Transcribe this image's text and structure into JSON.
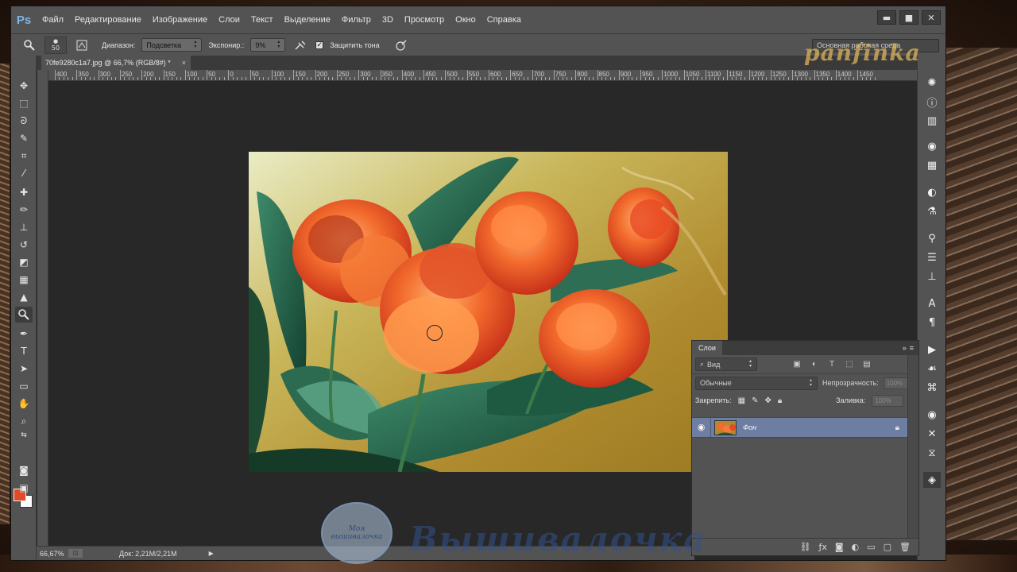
{
  "app": {
    "logo": "Ps"
  },
  "menu": [
    "Файл",
    "Редактирование",
    "Изображение",
    "Слои",
    "Текст",
    "Выделение",
    "Фильтр",
    "3D",
    "Просмотр",
    "Окно",
    "Справка"
  ],
  "window_controls": {
    "minimize": "▬",
    "maximize": "■",
    "close": "✕"
  },
  "options": {
    "brush_size": "50",
    "range_label": "Диапазон:",
    "range_value": "Подсветка",
    "exposure_label": "Экспонир.:",
    "exposure_value": "9%",
    "protect_tones_label": "Защитить тона",
    "protect_tones_checked": true,
    "workspace": "Основная рабочая среда"
  },
  "document_tab": {
    "title": "70fe9280c1a7.jpg @ 66,7% (RGB/8#) *",
    "close": "×"
  },
  "ruler": {
    "top_labels": [
      "400",
      "350",
      "300",
      "250",
      "200",
      "150",
      "100",
      "50",
      "0",
      "50",
      "100",
      "150",
      "200",
      "250",
      "300",
      "350",
      "400",
      "450",
      "500",
      "550",
      "600",
      "650",
      "700",
      "750",
      "800",
      "850",
      "900",
      "950",
      "1000",
      "1050",
      "1100",
      "1150",
      "1200",
      "1250",
      "1300",
      "1350",
      "1400",
      "1450"
    ]
  },
  "status": {
    "zoom": "66,67%",
    "doc": "Док: 2,21M/2,21M"
  },
  "layers_panel": {
    "title": "Слои",
    "filter": "Вид",
    "blend_mode": "Обычные",
    "opacity_label": "Непрозрачность:",
    "opacity_value": "100%",
    "lock_label": "Закрепить:",
    "fill_label": "Заливка:",
    "fill_value": "100%",
    "layers": [
      {
        "name": "Фон",
        "visible": true,
        "locked": true
      }
    ]
  },
  "watermarks": {
    "top": "panfinka",
    "badge": "Моя вышивалочка",
    "bottom": "Вышивалочка"
  },
  "colors": {
    "foreground": "#e24a2a",
    "background": "#ffffff",
    "selected_layer": "#6e7ea3"
  }
}
